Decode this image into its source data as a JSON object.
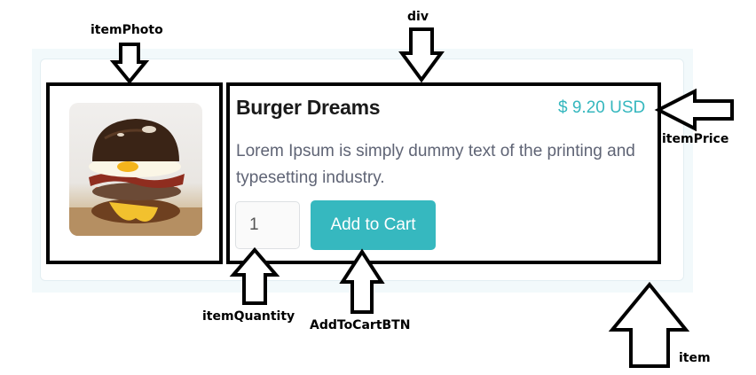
{
  "product": {
    "title": "Burger Dreams",
    "price": "$ 9.20 USD",
    "description": "Lorem Ipsum is simply dummy text of the printing and typesetting industry.",
    "quantity": "1",
    "add_to_cart_label": "Add to Cart",
    "image": "burger-photo"
  },
  "annotations": {
    "item_photo": "itemPhoto",
    "div": "div",
    "item_price": "itemPrice",
    "item_quantity": "itemQuantity",
    "add_to_cart_btn": "AddToCartBTN",
    "item": "item"
  },
  "colors": {
    "accent": "#36b8bf",
    "price": "#35b7be",
    "title": "#1a1a1a",
    "description": "#5f6475",
    "annotation": "#000000",
    "card_bg": "#f2f9fb"
  }
}
